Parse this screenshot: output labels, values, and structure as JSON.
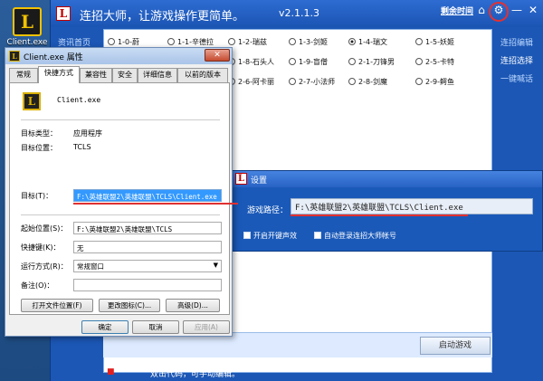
{
  "desktop": {
    "icon_label": "Client.exe",
    "icon_glyph": "L"
  },
  "app": {
    "logo": "L",
    "title": "连招大师，让游戏操作更简单。",
    "version": "v2.1.1.3",
    "remaining_time": "剩余时间",
    "nav_items": [
      "资讯首页"
    ],
    "right_nav": [
      "连招编辑",
      "连招选择",
      "一键喊话"
    ],
    "radios": [
      {
        "label": "1-0-蔚",
        "selected": false
      },
      {
        "label": "1-1-辛德拉",
        "selected": false
      },
      {
        "label": "1-2-瑞兹",
        "selected": false
      },
      {
        "label": "1-3-剑姬",
        "selected": false
      },
      {
        "label": "1-4-瑞文",
        "selected": true
      },
      {
        "label": "1-5-妖姬",
        "selected": false
      },
      {
        "label": "1-8-石头人",
        "selected": false
      },
      {
        "label": "1-9-盲僧",
        "selected": false
      },
      {
        "label": "2-1-刀锋男",
        "selected": false
      },
      {
        "label": "2-5-卡特",
        "selected": false
      },
      {
        "label": "2-6-阿卡丽",
        "selected": false
      },
      {
        "label": "2-7-小法师",
        "selected": false
      },
      {
        "label": "2-8-剑魔",
        "selected": false
      },
      {
        "label": "2-9-鳄鱼",
        "selected": false
      }
    ],
    "start_button": "启动游戏",
    "footer_hint": "双击代码，可手动编辑。"
  },
  "settings": {
    "logo": "L",
    "title": "设置",
    "path_label": "游戏路径：",
    "path_value": "F:\\英雄联盟2\\英雄联盟\\TCLS\\Client.exe",
    "checkbox_1": "开启开键声效",
    "checkbox_2": "自动登录连招大师帐号"
  },
  "properties": {
    "title": "Client.exe 属性",
    "close_label": "✕",
    "tabs": [
      "常规",
      "快捷方式",
      "兼容性",
      "安全",
      "详细信息",
      "以前的版本"
    ],
    "file_name": "Client.exe",
    "target_type_label": "目标类型：",
    "target_type_value": "应用程序",
    "target_location_label": "目标位置：",
    "target_location_value": "TCLS",
    "target_label": "目标(T)：",
    "target_value": "F:\\英雄联盟2\\英雄联盟\\TCLS\\Client.exe",
    "start_in_label": "起始位置(S)：",
    "start_in_value": "F:\\英雄联盟2\\英雄联盟\\TCLS",
    "shortcut_key_label": "快捷键(K)：",
    "shortcut_key_value": "无",
    "run_label": "运行方式(R)：",
    "run_value": "常规窗口",
    "comment_label": "备注(O)：",
    "comment_value": "",
    "btn_open_location": "打开文件位置(F)",
    "btn_change_icon": "更改图标(C)...",
    "btn_advanced": "高级(D)...",
    "btn_ok": "确定",
    "btn_cancel": "取消",
    "btn_apply": "应用(A)"
  },
  "colors": {
    "app_bg": "#1c57b5",
    "highlight_red": "#e03030",
    "selection_blue": "#3399ff"
  }
}
